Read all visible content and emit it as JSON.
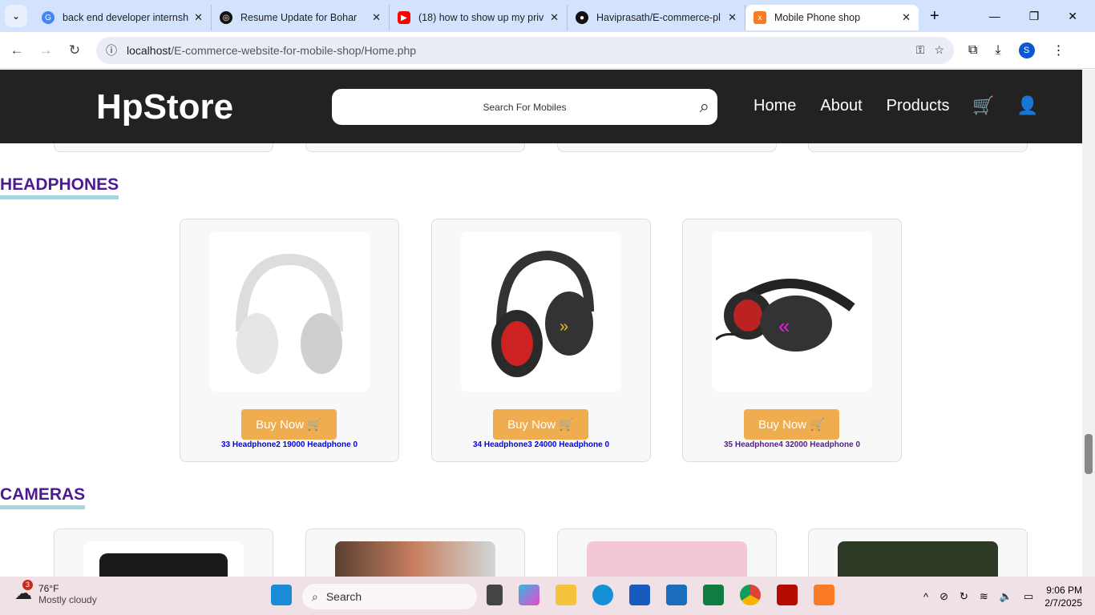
{
  "browser": {
    "tabs": [
      {
        "title": "back end developer internsh",
        "icon": "google-icon",
        "color": "#4285f4"
      },
      {
        "title": "Resume Update for Bohar",
        "icon": "chatgpt-icon",
        "color": "#111111"
      },
      {
        "title": "(18) how to show up my priv",
        "icon": "youtube-icon",
        "color": "#ff0000"
      },
      {
        "title": "Haviprasath/E-commerce-pl",
        "icon": "github-icon",
        "color": "#111111"
      },
      {
        "title": "Mobile Phone shop",
        "icon": "xampp-icon",
        "color": "#fb7a24",
        "active": true
      }
    ],
    "url_host": "localhost",
    "url_path": "/E-commerce-website-for-mobile-shop/Home.php",
    "profile_initial": "S"
  },
  "site": {
    "logo": "HpStore",
    "search_placeholder": "Search For Mobiles",
    "nav": [
      "Home",
      "About",
      "Products"
    ]
  },
  "sections": [
    {
      "title": "HEADPHONES",
      "products": [
        {
          "buy_label": "Buy Now 🛒",
          "info": "33 Headphone2 19000 Headphone 0"
        },
        {
          "buy_label": "Buy Now 🛒",
          "info": "34 Headphone3 24000 Headphone 0"
        },
        {
          "buy_label": "Buy Now 🛒",
          "info": "35 Headphone4 32000 Headphone 0"
        }
      ]
    },
    {
      "title": "CAMERAS"
    }
  ],
  "taskbar": {
    "temp": "76°F",
    "weather": "Mostly cloudy",
    "badge": "3",
    "search": "Search",
    "time": "9:06 PM",
    "date": "2/7/2025"
  }
}
